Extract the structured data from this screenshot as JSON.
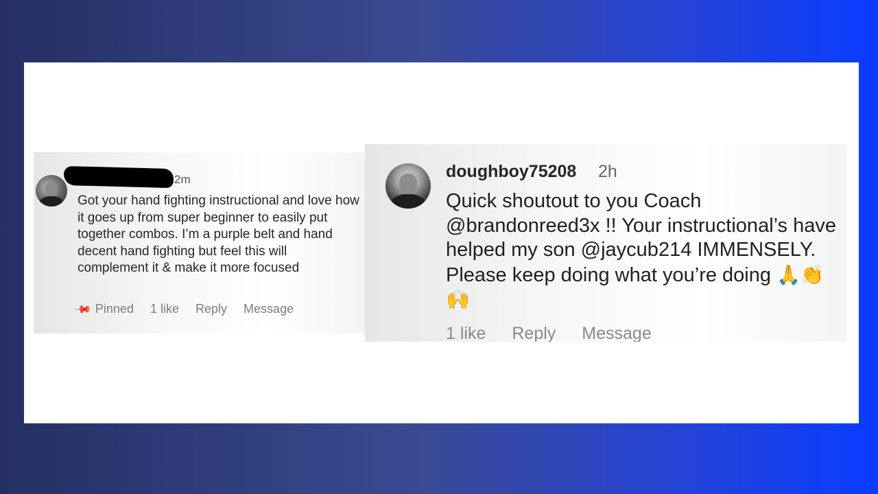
{
  "left_comment": {
    "time": "2m",
    "text": "Got your hand fighting instructional and love how it goes up from super beginner to easily put together combos. I’m a purple belt and hand decent hand fighting but feel this will complement it & make it more focused",
    "actions": {
      "pinned": "Pinned",
      "likes": "1 like",
      "reply": "Reply",
      "message": "Message"
    },
    "icons": {
      "pin": "pushpin-icon"
    }
  },
  "right_comment": {
    "username": "doughboy75208",
    "time": "2h",
    "text": "Quick shoutout to you Coach @brandonreed3x !! Your instructional’s have helped my son @jaycub214 IMMENSELY. Please keep doing what you’re doing",
    "emojis": "🙏👏🙌",
    "actions": {
      "likes": "1 like",
      "reply": "Reply",
      "message": "Message"
    }
  },
  "colors": {
    "background_left": "#252f63",
    "background_right": "#0a3cff",
    "card": "#ffffff",
    "text": "#262626",
    "muted": "#7d7d7d"
  }
}
